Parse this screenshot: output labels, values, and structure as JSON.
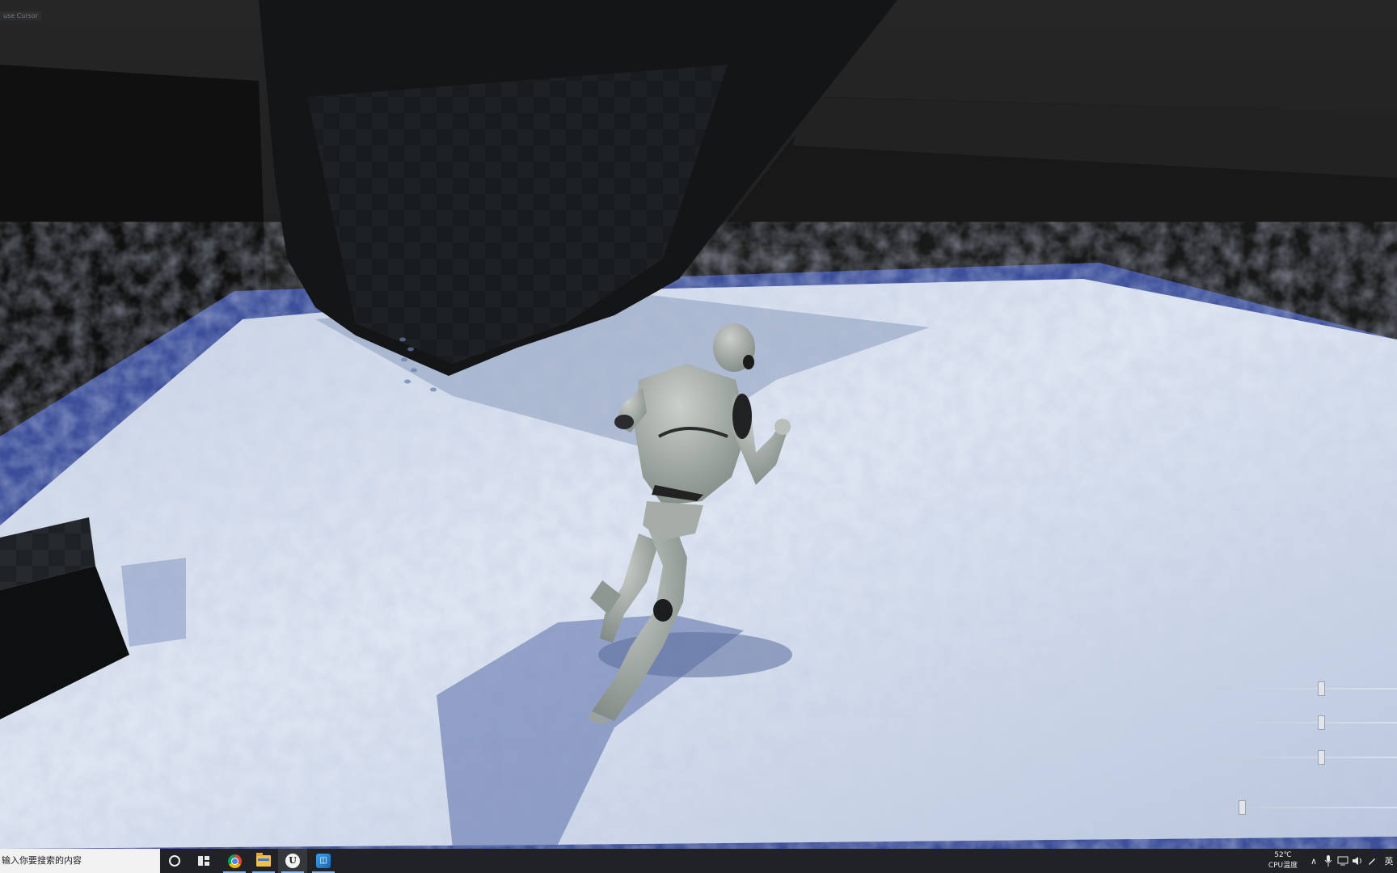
{
  "viewport": {
    "debug_label": "use Cursor"
  },
  "sliders": [
    {
      "name": "slider-1",
      "value": 0.56
    },
    {
      "name": "slider-2",
      "value": 0.56
    },
    {
      "name": "slider-3",
      "value": 0.56
    },
    {
      "name": "slider-4",
      "value": 0.12
    }
  ],
  "taskbar": {
    "search_placeholder": "输入你要搜索的内容",
    "apps": [
      {
        "icon": "cortana-icon"
      },
      {
        "icon": "task-view-icon"
      },
      {
        "icon": "chrome-icon"
      },
      {
        "icon": "file-explorer-icon"
      },
      {
        "icon": "unreal-engine-icon",
        "label": "U"
      },
      {
        "icon": "app-icon"
      }
    ],
    "tray": {
      "cpu_temp": "52℃",
      "cpu_label": "CPU温度",
      "chevron": "∧",
      "ime_label": "英"
    }
  }
}
